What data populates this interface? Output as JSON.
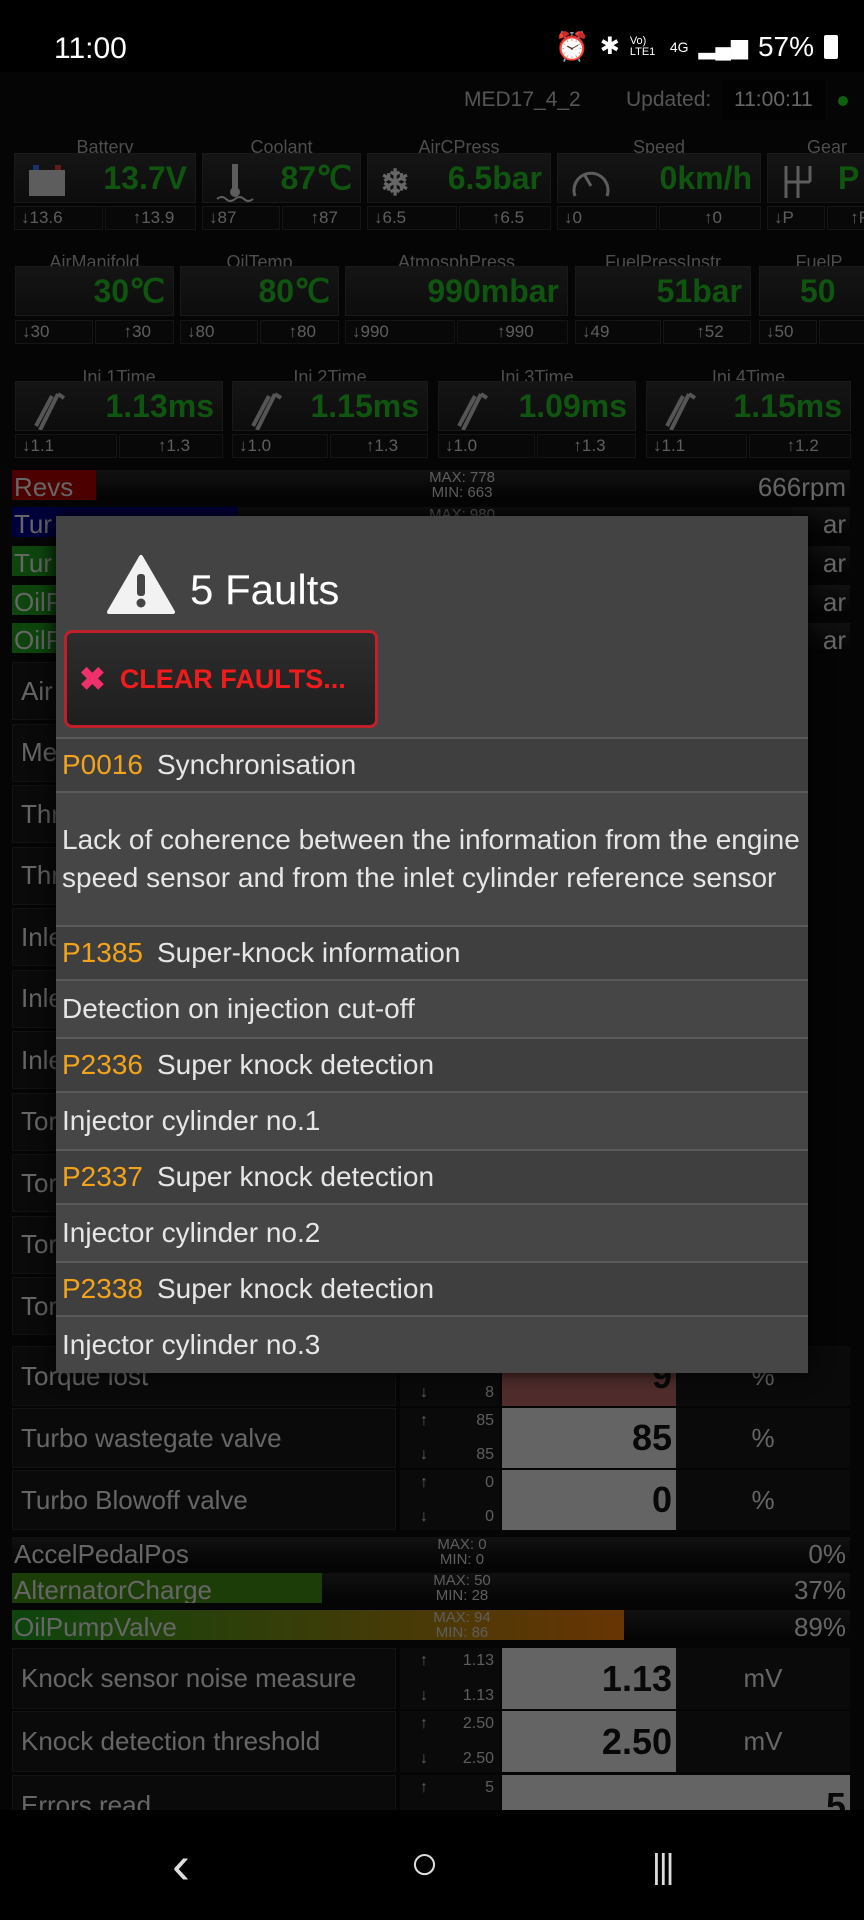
{
  "status_bar": {
    "time": "11:00",
    "icons": [
      "alarm-icon",
      "bluetooth-icon",
      "volte-icon",
      "4g-icon",
      "signal-icon",
      "battery-icon"
    ],
    "volte": "Vo) LTE1",
    "net": "4G",
    "battery": "57%"
  },
  "header": {
    "ecu": "MED17_4_2",
    "updated_label": "Updated:",
    "updated_time": "11:00:11",
    "status_color": "#1fbf1f"
  },
  "gauge_rows": [
    [
      {
        "label": "Battery",
        "value": "13.7V",
        "icon": "car-battery-icon",
        "min": "↓13.6",
        "max": "↑13.9"
      },
      {
        "label": "Coolant",
        "value": "87℃",
        "icon": "coolant-thermometer-icon",
        "min": "↓87",
        "max": "↑87"
      },
      {
        "label": "AirCPress",
        "value": "6.5bar",
        "icon": "snowflake-icon",
        "min": "↓6.5",
        "max": "↑6.5"
      },
      {
        "label": "Speed",
        "value": "0km/h",
        "icon": "speedometer-icon",
        "min": "↓0",
        "max": "↑0"
      },
      {
        "label": "Gear",
        "value": "P",
        "icon": "gear-shift-icon",
        "min": "↓P",
        "max": "↑P"
      }
    ],
    [
      {
        "label": "AirManifold",
        "value": "30℃",
        "min": "↓30",
        "max": "↑30"
      },
      {
        "label": "OilTemp",
        "value": "80℃",
        "min": "↓80",
        "max": "↑80"
      },
      {
        "label": "AtmosphPress",
        "value": "990mbar",
        "min": "↓990",
        "max": "↑990"
      },
      {
        "label": "FuelPressInstr",
        "value": "51bar",
        "min": "↓49",
        "max": "↑52"
      },
      {
        "label": "FuelP",
        "value": "50",
        "min": "↓50",
        "max": ""
      }
    ],
    [
      {
        "label": "Inj.1Time",
        "value": "1.13ms",
        "icon": "injector-icon",
        "min": "↓1.1",
        "max": "↑1.3"
      },
      {
        "label": "Inj.2Time",
        "value": "1.15ms",
        "icon": "injector-icon",
        "min": "↓1.0",
        "max": "↑1.3"
      },
      {
        "label": "Inj.3Time",
        "value": "1.09ms",
        "icon": "injector-icon",
        "min": "↓1.0",
        "max": "↑1.3"
      },
      {
        "label": "Inj.4Time",
        "value": "1.15ms",
        "icon": "injector-icon",
        "min": "↓1.1",
        "max": "↑1.2"
      }
    ]
  ],
  "bars_top": [
    {
      "label": "Revs",
      "max": "MAX: 778",
      "min": "MIN: 663",
      "value": "666rpm",
      "fill_pct": 10,
      "color": "#9a0000"
    },
    {
      "label": "Tur",
      "max": "MAX: 980",
      "min": "",
      "value": "ar",
      "fill_pct": 27,
      "color": "#00007a"
    },
    {
      "label": "Tur",
      "max": "",
      "min": "",
      "value": "ar",
      "fill_pct": 12,
      "color": "#1a8a1a"
    },
    {
      "label": "OilP",
      "max": "",
      "min": "",
      "value": "ar",
      "fill_pct": 12,
      "color": "#1a8a1a"
    },
    {
      "label": "OilP",
      "max": "",
      "min": "",
      "value": "ar",
      "fill_pct": 12,
      "color": "#1a8a1a"
    }
  ],
  "table_hidden": [
    "Air",
    "Me",
    "Thr",
    "Thr",
    "Inle",
    "Inle",
    "Inle",
    "Tor",
    "Tor",
    "Tor",
    "Tor"
  ],
  "table": [
    {
      "label": "Torque lost",
      "max": "",
      "min": "8",
      "value": "9",
      "unit": "%",
      "value_color": "#a05a58"
    },
    {
      "label": "Turbo wastegate valve",
      "max": "85",
      "min": "85",
      "value": "85",
      "unit": "%"
    },
    {
      "label": "Turbo Blowoff valve",
      "max": "0",
      "min": "0",
      "value": "0",
      "unit": "%"
    }
  ],
  "bars_bottom": [
    {
      "label": "AccelPedalPos",
      "max": "MAX: 0",
      "min": "MIN: 0",
      "value": "0%",
      "fill_pct": 0,
      "color": "#1a8a1a"
    },
    {
      "label": "AlternatorCharge",
      "max": "MAX: 50",
      "min": "MIN: 28",
      "value": "37%",
      "fill_pct": 37,
      "color": "#3a7a10"
    },
    {
      "label": "OilPumpValve",
      "max": "MAX: 94",
      "min": "MIN: 86",
      "value": "89%",
      "fill_pct": 73,
      "color": "#d06a08"
    }
  ],
  "table2": [
    {
      "label": "Knock sensor noise measure",
      "max": "1.13",
      "min": "1.13",
      "value": "1.13",
      "unit": "mV"
    },
    {
      "label": "Knock detection threshold",
      "max": "2.50",
      "min": "2.50",
      "value": "2.50",
      "unit": "mV"
    },
    {
      "label": "Errors read",
      "max": "5",
      "min": "",
      "value": "5",
      "unit": ""
    }
  ],
  "dialog": {
    "title": "5 Faults",
    "icon": "warning-icon",
    "clear_button": "CLEAR FAULTS...",
    "faults": [
      {
        "code": "P0016",
        "name": "Synchronisation",
        "description": "Lack of coherence between the information from the engine speed sensor and from the inlet cylinder reference sensor"
      },
      {
        "code": "P1385",
        "name": "Super-knock information",
        "description": "Detection on injection cut-off"
      },
      {
        "code": "P2336",
        "name": "Super knock detection",
        "description": "Injector cylinder no.1"
      },
      {
        "code": "P2337",
        "name": "Super knock detection",
        "description": "Injector cylinder no.2"
      },
      {
        "code": "P2338",
        "name": "Super knock detection",
        "description": "Injector cylinder no.3"
      }
    ]
  },
  "nav": {
    "back": "‹",
    "home": "○",
    "recents": "|||"
  }
}
